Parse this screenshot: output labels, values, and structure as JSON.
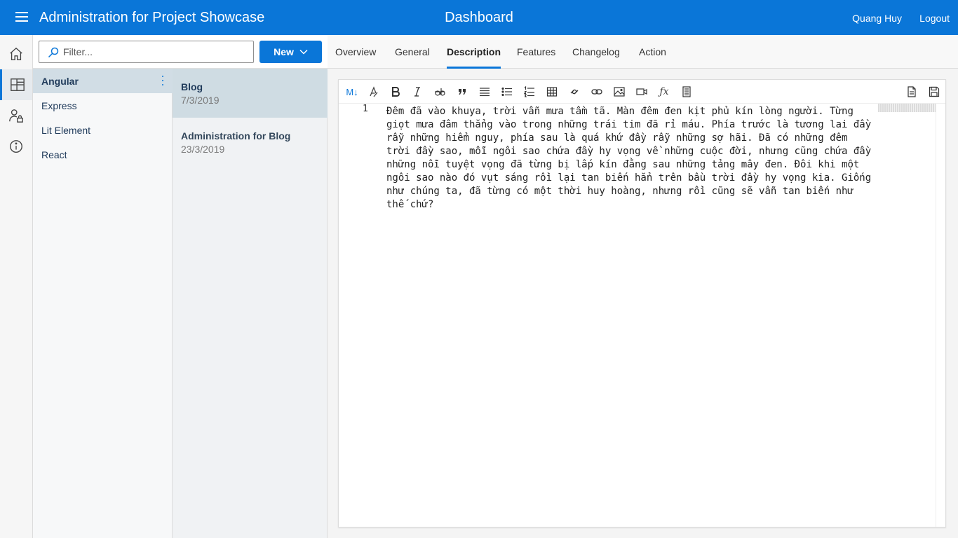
{
  "header": {
    "app_title": "Administration for Project Showcase",
    "page_title": "Dashboard",
    "user_name": "Quang Huy",
    "logout_label": "Logout"
  },
  "colors": {
    "brand": "#0a76d8",
    "selected_row": "#d1dde5"
  },
  "rail": {
    "items": [
      {
        "icon": "home-icon"
      },
      {
        "icon": "dashboard-icon",
        "active": true
      },
      {
        "icon": "user-lock-icon"
      },
      {
        "icon": "info-icon"
      }
    ]
  },
  "filter": {
    "placeholder": "Filter...",
    "value": ""
  },
  "new_button": {
    "label": "New"
  },
  "projects": [
    {
      "label": "Angular",
      "selected": true
    },
    {
      "label": "Express"
    },
    {
      "label": "Lit Element"
    },
    {
      "label": "React"
    }
  ],
  "entries": [
    {
      "title": "Blog",
      "date": "7/3/2019",
      "selected": true
    },
    {
      "title": "Administration for Blog",
      "date": "23/3/2019"
    }
  ],
  "tabs": [
    {
      "label": "Overview"
    },
    {
      "label": "General"
    },
    {
      "label": "Description",
      "active": true
    },
    {
      "label": "Features"
    },
    {
      "label": "Changelog"
    },
    {
      "label": "Action"
    }
  ],
  "editor": {
    "mode_label": "M↓",
    "line_number": "1",
    "content": "Đêm đã vào khuya, trời vẫn mưa tầm tã. Màn đêm đen kịt phủ kín lòng người. Từng giọt mưa đâm thẳng vào trong những trái tim đã rỉ máu. Phía trước là tương lai đầy rẫy những hiểm nguy, phía sau là quá khứ đầy rẫy những sợ hãi. Đã có những đêm trời đầy sao, mỗi ngôi sao chứa đầy hy vọng về những cuộc đời, nhưng cũng chứa đầy những nỗi tuyệt vọng đã từng bị lấp kín đằng sau những tảng mây đen. Đôi khi một ngôi sao nào đó vụt sáng rồi lại tan biến hẳn trên bầu trời đầy hy vọng kia. Giống như chúng ta, đã từng có một thời huy hoàng, nhưng rồi cũng sẽ vẫn tan biến như thế chứ?"
  }
}
